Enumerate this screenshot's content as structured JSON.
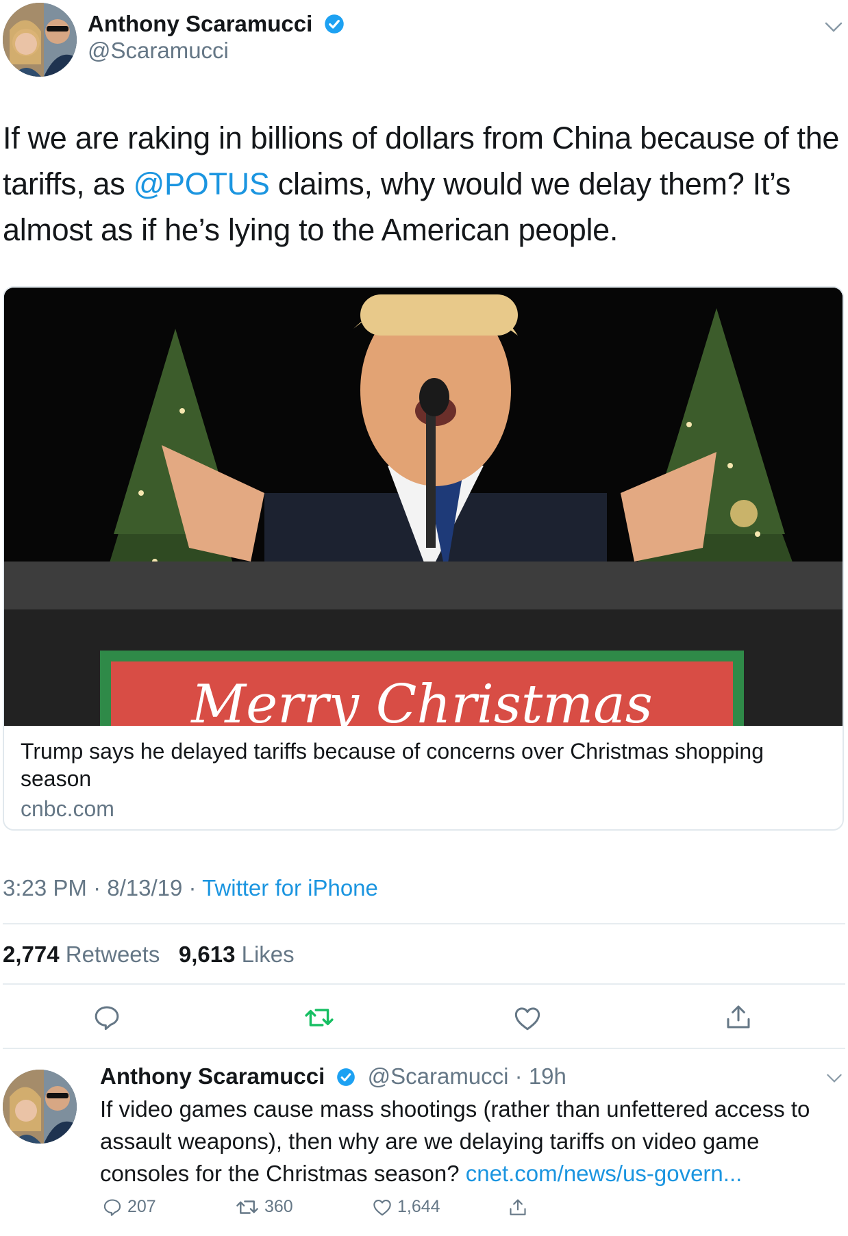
{
  "tweet": {
    "author_name": "Anthony Scaramucci",
    "author_handle": "@Scaramucci",
    "text_before": "If we are raking in billions of dollars from China because of the tariffs, as ",
    "mention": "@POTUS",
    "text_after": " claims, why would we delay them? It’s almost as if he’s lying to the American people.",
    "card": {
      "title": "Trump says he delayed tariffs because of concerns over Christmas shopping season",
      "domain": "cnbc.com",
      "sign_text": "Merry Christmas"
    },
    "time": "3:23 PM",
    "date": "8/13/19",
    "source": "Twitter for iPhone",
    "retweets_count": "2,774",
    "retweets_label": "Retweets",
    "likes_count": "9,613",
    "likes_label": "Likes"
  },
  "reply_tweet": {
    "author_name": "Anthony Scaramucci",
    "handle_time": "@Scaramucci · 19h",
    "text": "If video games cause mass shootings (rather than unfettered access to assault weapons), then why are we delaying tariffs on video game consoles for the Christmas season? ",
    "link": "cnet.com/news/us-govern...",
    "replies": "207",
    "retweets": "360",
    "likes": "1,644"
  },
  "colors": {
    "link_blue": "#1b95e0",
    "retweet_green": "#17bf63",
    "muted_gray": "#657786",
    "divider": "#e6ecf0",
    "verified_blue": "#1da1f2"
  },
  "icons": [
    "verified-badge-icon",
    "chevron-down-icon",
    "reply-icon",
    "retweet-icon",
    "like-icon",
    "share-icon"
  ]
}
